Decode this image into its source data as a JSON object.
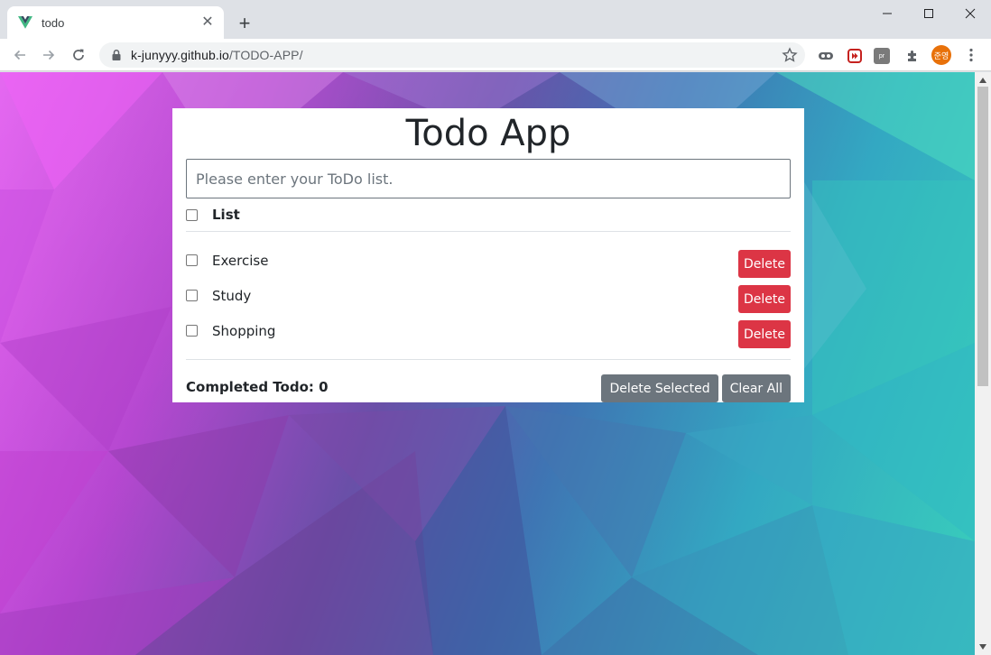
{
  "browser": {
    "tab_title": "todo",
    "tab_favicon": "vue-logo-icon",
    "url_host": "k-junyyy.github.io",
    "url_path": "/TODO-APP/",
    "profile_initials": "준영",
    "extension_label": "pr"
  },
  "app": {
    "title": "Todo App",
    "input_placeholder": "Please enter your ToDo list.",
    "list_header": "List",
    "items": [
      {
        "label": "Exercise",
        "done": false
      },
      {
        "label": "Study",
        "done": false
      },
      {
        "label": "Shopping",
        "done": false
      }
    ],
    "delete_label": "Delete",
    "completed_label": "Completed Todo: 0",
    "delete_selected_label": "Delete Selected",
    "clear_all_label": "Clear All"
  },
  "colors": {
    "danger": "#dc3545",
    "secondary": "#6c757d",
    "vue_green": "#41b883",
    "vue_dark": "#34495e",
    "profile_orange": "#e8710a"
  }
}
